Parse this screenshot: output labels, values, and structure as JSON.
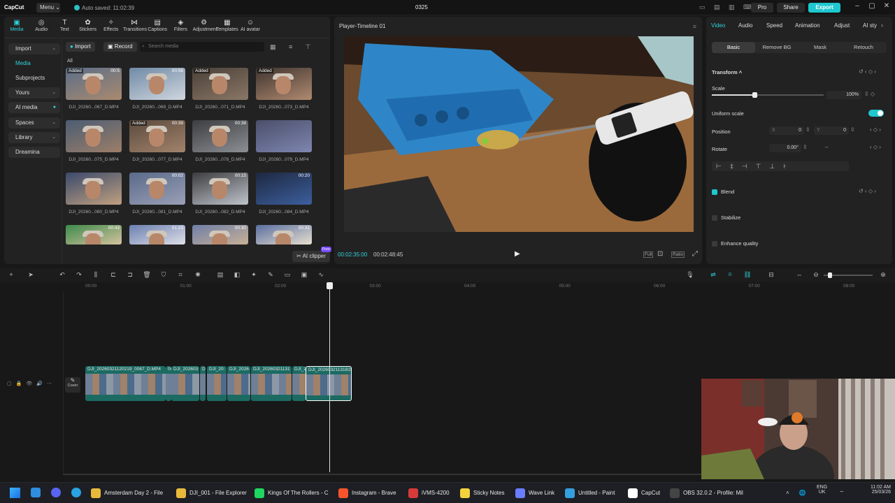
{
  "titlebar": {
    "app": "CapCut",
    "menu": "Menu",
    "autosave": "Auto saved: 11:02:39",
    "project": "0325",
    "pro": "Pro",
    "share": "Share",
    "export": "Export"
  },
  "media_tools": [
    "Media",
    "Audio",
    "Text",
    "Stickers",
    "Effects",
    "Transitions",
    "Captions",
    "Filters",
    "Adjustment",
    "Templates",
    "AI avatar"
  ],
  "media_tool_icons": [
    "media-icon",
    "audio-icon",
    "text-icon",
    "stickers-icon",
    "effects-icon",
    "transitions-icon",
    "captions-icon",
    "filters-icon",
    "adjustment-icon",
    "templates-icon",
    "ai-avatar-icon"
  ],
  "sidebar": [
    "Import",
    "Media",
    "Subprojects",
    "Yours",
    "AI media",
    "Spaces",
    "Library",
    "Dreamina"
  ],
  "media": {
    "import": "Import",
    "record": "Record",
    "search_placeholder": "Search media",
    "filter": "All",
    "ai_clipper": "AI clipper",
    "free": "Free",
    "items": [
      {
        "name": "DJI_20260...067_D.MP4",
        "badge": "Added",
        "dur": "00:5"
      },
      {
        "name": "DJI_20260...069_D.MP4",
        "badge": "",
        "dur": "00:56"
      },
      {
        "name": "DJI_20260...071_D.MP4",
        "badge": "Added",
        "dur": ""
      },
      {
        "name": "DJI_20260...073_D.MP4",
        "badge": "Added",
        "dur": ""
      },
      {
        "name": "DJI_20260...075_D.MP4",
        "badge": "",
        "dur": ""
      },
      {
        "name": "DJI_20260...077_D.MP4",
        "badge": "Added",
        "dur": "00:39"
      },
      {
        "name": "DJI_20260...078_D.MP4",
        "badge": "",
        "dur": "00:38"
      },
      {
        "name": "DJI_20260...079_D.MP4",
        "badge": "",
        "dur": ""
      },
      {
        "name": "DJI_20260...080_D.MP4",
        "badge": "",
        "dur": ""
      },
      {
        "name": "DJI_20260...081_D.MP4",
        "badge": "",
        "dur": "00:02"
      },
      {
        "name": "DJI_20260...082_D.MP4",
        "badge": "",
        "dur": "00:15"
      },
      {
        "name": "DJI_20260...084_D.MP4",
        "badge": "",
        "dur": "00:20"
      },
      {
        "name": "",
        "badge": "",
        "dur": "00:43"
      },
      {
        "name": "",
        "badge": "",
        "dur": "01:23"
      },
      {
        "name": "",
        "badge": "",
        "dur": "00:30"
      },
      {
        "name": "",
        "badge": "",
        "dur": "00:31"
      }
    ]
  },
  "player": {
    "title": "Player-Timeline 01",
    "current": "00:02:35:00",
    "total": "00:02:48:45",
    "full": "Full",
    "ratio": "Ratio"
  },
  "inspector": {
    "tabs": [
      "Video",
      "Audio",
      "Speed",
      "Animation",
      "Adjust",
      "AI sty"
    ],
    "subtabs": [
      "Basic",
      "Remove BG",
      "Mask",
      "Retouch"
    ],
    "transform": "Transform",
    "scale": "Scale",
    "scale_value": "100%",
    "uniform": "Uniform scale",
    "position": "Position",
    "x_label": "X",
    "x": "0",
    "y_label": "Y",
    "y": "0",
    "rotate": "Rotate",
    "rotate_value": "0.00°",
    "blend": "Blend",
    "stabilize": "Stabilize",
    "enhance": "Enhance quality",
    "scale_level": 0.38
  },
  "ruler": [
    "00:00",
    "01:00",
    "02:00",
    "03:00",
    "04:00",
    "05:00",
    "06:00",
    "07:00",
    "08:00"
  ],
  "timeline": {
    "cover": "Cover",
    "clips": [
      {
        "label": "DJI_20260321120219_0067_D.MP4"
      },
      {
        "label": "00"
      },
      {
        "label": "DJI_202603"
      },
      {
        "label": "D"
      },
      {
        "label": "DJI_20:"
      },
      {
        "label": "DJI_2026"
      },
      {
        "label": "DJI_20260321131"
      },
      {
        "label": "DJI_2"
      },
      {
        "label": "DJI_20260321131819"
      }
    ]
  },
  "taskbar": {
    "apps": [
      {
        "label": "Amsterdam Day 2 - File",
        "color": "#e8b93a"
      },
      {
        "label": "DJI_001 - File Explorer",
        "color": "#e8b93a"
      },
      {
        "label": "Kings Of The Rollers - C",
        "color": "#1ed760"
      },
      {
        "label": "Instagram - Brave",
        "color": "#fb542b"
      },
      {
        "label": "iVMS-4200",
        "color": "#d83a3a"
      },
      {
        "label": "Sticky Notes",
        "color": "#f3d23b"
      },
      {
        "label": "Wave Link",
        "color": "#6a7cff"
      },
      {
        "label": "Untitled - Paint",
        "color": "#35a0e0"
      },
      {
        "label": "CapCut",
        "color": "#ffffff"
      },
      {
        "label": "OBS 32.0.2 - Profile: Mil",
        "color": "#444444"
      }
    ],
    "lang1": "ENG",
    "lang2": "UK",
    "time": "11:02 AM",
    "date": "25/03/26"
  }
}
